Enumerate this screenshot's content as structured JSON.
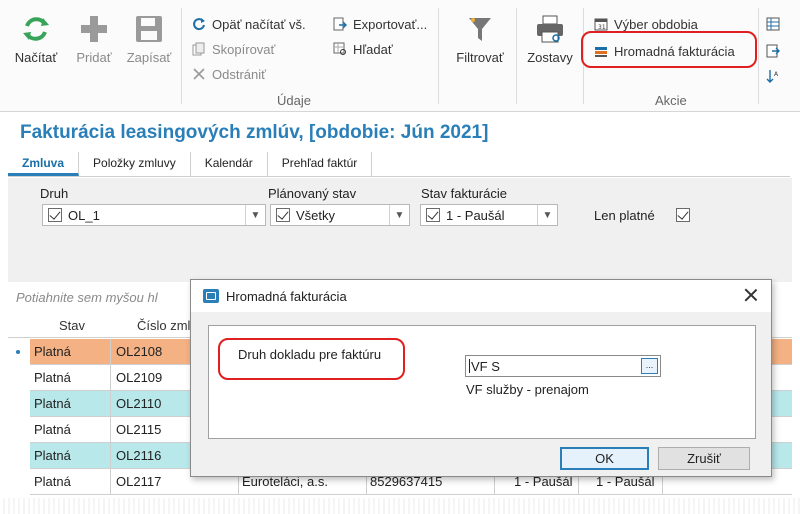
{
  "ribbon": {
    "buttons": {
      "reload": "Načítať",
      "add": "Pridať",
      "save": "Zapísať",
      "filter": "Filtrovať",
      "reports": "Zostavy"
    },
    "data_group": {
      "reload_all": "Opäť načítať vš.",
      "copy": "Skopírovať",
      "delete": "Odstrániť",
      "export": "Exportovať...",
      "search": "Hľadať",
      "label": "Údaje"
    },
    "actions_group": {
      "select_period": "Výber obdobia",
      "bulk_invoicing": "Hromadná fakturácia",
      "label": "Akcie"
    }
  },
  "page": {
    "title": "Fakturácia leasingových zmlúv, [obdobie: Jún 2021]"
  },
  "tabs": [
    {
      "label": "Zmluva"
    },
    {
      "label": "Položky zmluvy"
    },
    {
      "label": "Kalendár"
    },
    {
      "label": "Prehľad faktúr"
    }
  ],
  "filters": {
    "type_label": "Druh",
    "type_value": "OL_1",
    "planned_state_label": "Plánovaný stav",
    "planned_state_value": "Všetky",
    "billing_state_label": "Stav fakturácie",
    "billing_state_value": "1 - Paušál",
    "only_valid_label": "Len platné"
  },
  "grid": {
    "drag_hint": "Potiahnite sem myšou hl",
    "headers": {
      "state": "Stav",
      "contract_no": "Číslo zml"
    },
    "rows": [
      {
        "state": "Platná",
        "contract": "OL2108",
        "company": "",
        "ico": "",
        "c5": "",
        "c6": ""
      },
      {
        "state": "Platná",
        "contract": "OL2109",
        "company": "",
        "ico": "",
        "c5": "",
        "c6": ""
      },
      {
        "state": "Platná",
        "contract": "OL2110",
        "company": "",
        "ico": "",
        "c5": "",
        "c6": ""
      },
      {
        "state": "Platná",
        "contract": "OL2115",
        "company": "",
        "ico": "",
        "c5": "",
        "c6": ""
      },
      {
        "state": "Platná",
        "contract": "OL2116",
        "company": "",
        "ico": "",
        "c5": "",
        "c6": ""
      },
      {
        "state": "Platná",
        "contract": "OL2117",
        "company": "Euroteláci, a.s.",
        "ico": "8529637415",
        "c5": "1 - Paušál",
        "c6": "1 - Paušál"
      }
    ],
    "colors": {
      "selected": "#f4b183",
      "alt": "#b8e8ea",
      "plain": "#ffffff"
    }
  },
  "dialog": {
    "title": "Hromadná fakturácia",
    "doc_type_label": "Druh dokladu pre faktúru",
    "doc_type_value": "VF S",
    "browse": "...",
    "doc_type_description": "VF služby - prenajom",
    "ok": "OK",
    "cancel": "Zrušiť"
  },
  "colors": {
    "accent": "#2a7fb8",
    "highlight_ring": "#e02020",
    "reload_icon": "#3aa35a"
  }
}
